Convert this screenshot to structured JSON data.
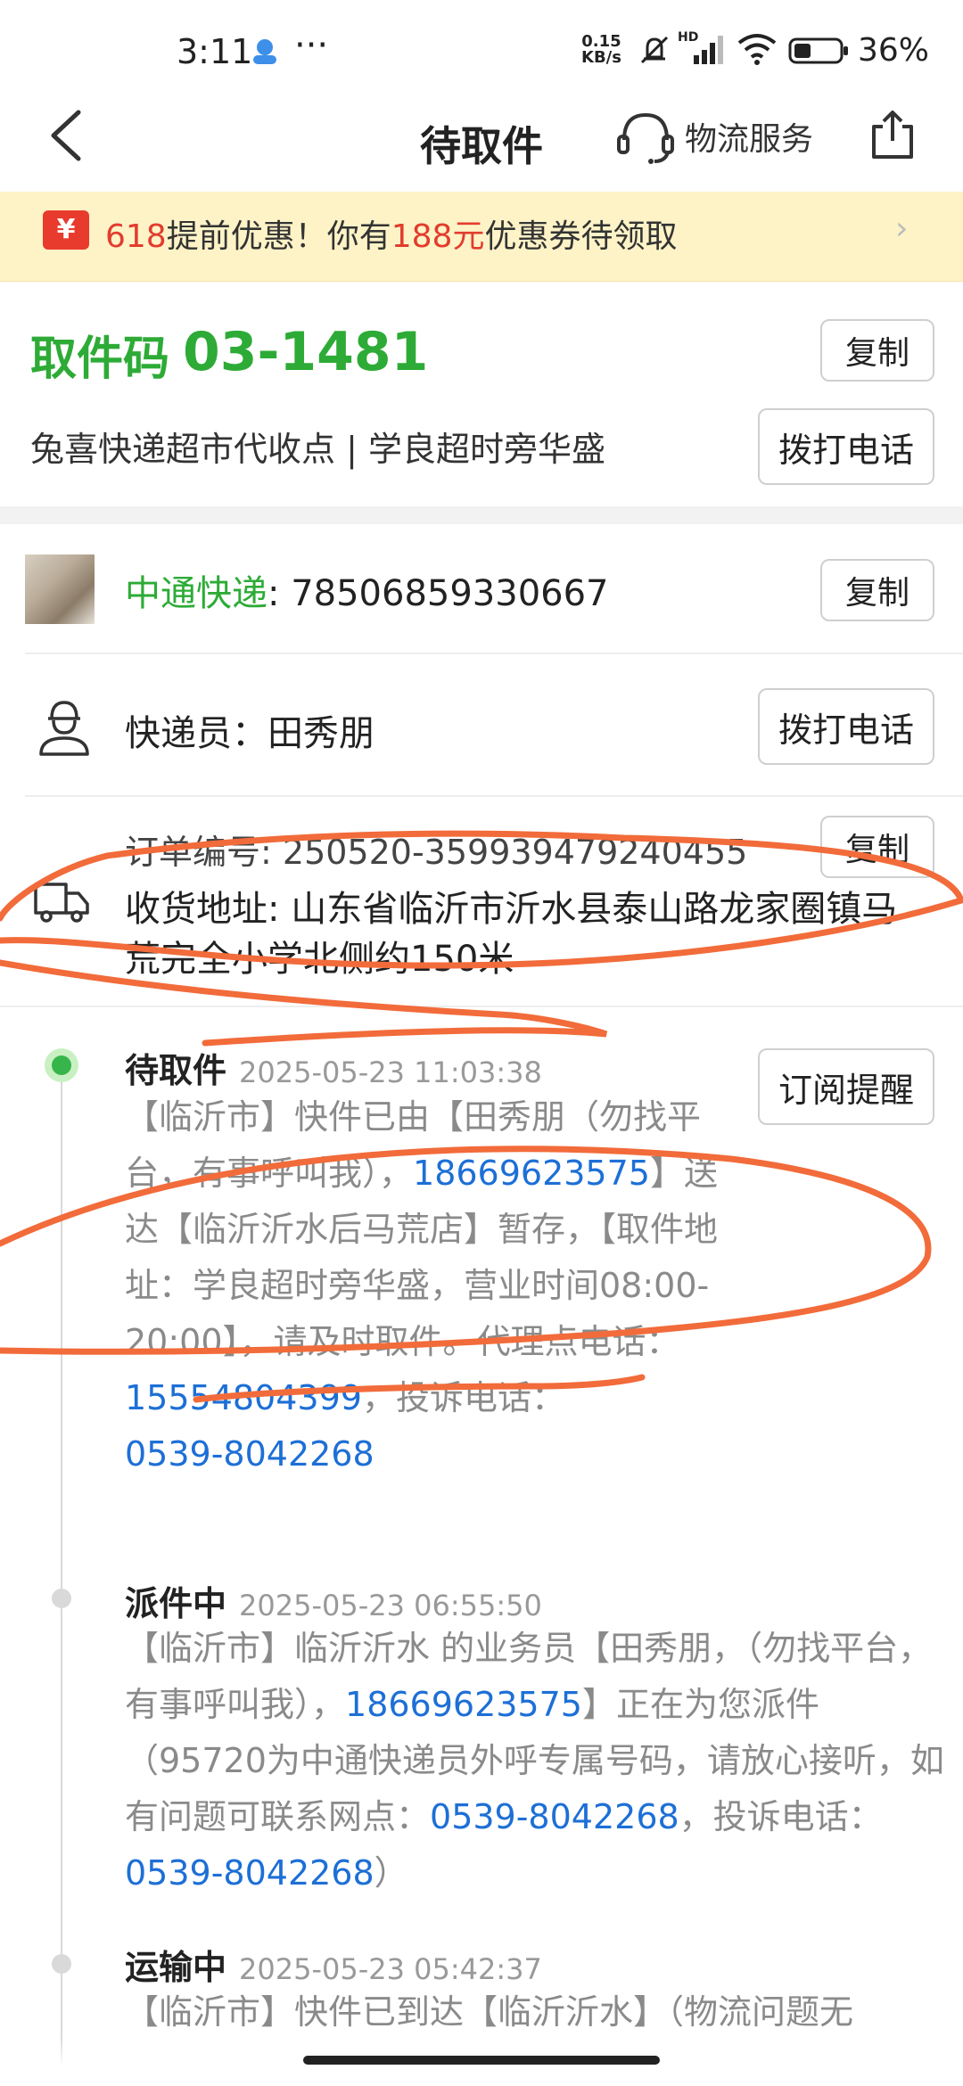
{
  "status_bar": {
    "time": "3:11",
    "ellipsis": "···",
    "net_speed_value": "0.15",
    "net_speed_unit": "KB/s",
    "hd": "HD",
    "battery": "36%"
  },
  "header": {
    "title": "待取件",
    "logistics_service": "物流服务"
  },
  "promo": {
    "icon_text": "¥",
    "part1": "618",
    "part2": "提前优惠！你有",
    "part3": "188元",
    "part4": "优惠券待领取",
    "chevron": "›"
  },
  "pickup": {
    "code_label": "取件码",
    "code": "03-1481",
    "store": "兔喜快递超市代收点 | 学良超时旁华盛",
    "copy_label": "复制",
    "call_label": "拨打电话"
  },
  "shipment": {
    "carrier": "中通快递",
    "tracking_sep": ": ",
    "tracking_no": "78506859330667",
    "copy_label": "复制",
    "courier_label": "快递员：",
    "courier_name": "田秀朋",
    "call_label": "拨打电话",
    "order_label": "订单编号: ",
    "order_no": "250520-359939479240455",
    "order_copy_label": "复制",
    "address_label": "收货地址: ",
    "address": "山东省临沂市沂水县泰山路龙家圈镇马荒完全小学北侧约150米"
  },
  "timeline": {
    "subscribe_label": "订阅提醒",
    "events": [
      {
        "status": "待取件",
        "time": "2025-05-23 11:03:38",
        "t1": "【临沂市】快件已由【田秀朋（勿找平台，有事呼叫我），",
        "phone1": "18669623575",
        "t2": "】送达【临沂沂水后马荒店】暂存，【取件地址：学良超时旁华盛，营业时间08:00-20:00】，请及时取件。代理点电话：",
        "phone2": "15554804399",
        "t3": "，投诉电话：",
        "phone3": "0539-8042268"
      },
      {
        "status": "派件中",
        "time": "2025-05-23 06:55:50",
        "t1": "【临沂市】临沂沂水 的业务员【田秀朋，（勿找平台，有事呼叫我），",
        "phone1": "18669623575",
        "t2": "】正在为您派件（95720为中通快递员外呼专属号码，请放心接听，如有问题可联系网点：",
        "phone2": "0539-8042268",
        "t3": "，投诉电话：",
        "phone3": "0539-8042268",
        "t4": "）"
      },
      {
        "status": "运输中",
        "time": "2025-05-23 05:42:37",
        "t1": "【临沂市】快件已到达【临沂沂水】（物流问题无"
      }
    ]
  },
  "colors": {
    "green": "#2dab36",
    "link_blue": "#1d6fd6",
    "promo_red": "#e23c2d",
    "promo_bg": "#fdf3c7",
    "scribble": "#f26b3a"
  }
}
